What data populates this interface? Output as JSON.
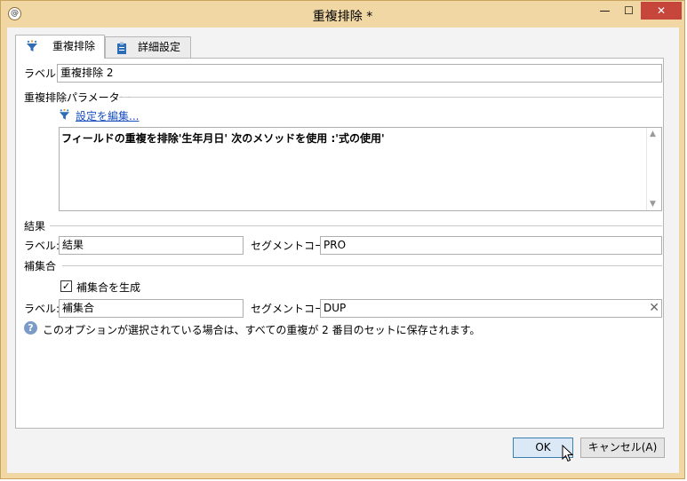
{
  "window": {
    "title": "重複排除 *",
    "app_icon": "adobe-campaign-icon",
    "minimize": "—",
    "maximize": "☐",
    "close": "✕"
  },
  "tabs": [
    {
      "label": "重複排除",
      "icon": "funnel-icon",
      "active": true
    },
    {
      "label": "詳細設定",
      "icon": "clipboard-icon",
      "active": false
    }
  ],
  "main": {
    "label_text": "ラベル:",
    "label_value": "重複排除 2",
    "params_section": "重複排除パラメーター",
    "edit_link": "設定を編集...",
    "description": "フィールドの重複を排除'生年月日' 次のメソッドを使用 :'式の使用'",
    "results_section": "結果",
    "results_label_text": "ラベル:",
    "results_label_value": "結果",
    "results_segment_text": "セグメントコード:",
    "results_segment_value": "PRO",
    "complement_section": "補集合",
    "complement_checkbox_label": "補集合を生成",
    "complement_checked": true,
    "complement_label_text": "ラベル:",
    "complement_label_value": "補集合",
    "complement_segment_text": "セグメントコード:",
    "complement_segment_value": "DUP",
    "info_text": "このオプションが選択されている場合は、すべての重複が 2 番目のセットに保存されます。"
  },
  "footer": {
    "ok_label": "OK",
    "cancel_label": "キャンセル(A)"
  },
  "colors": {
    "frame": "#f0d7a4",
    "close_button": "#c7463c",
    "link": "#1a4fbf",
    "primary_button": "#dbe9f7"
  }
}
